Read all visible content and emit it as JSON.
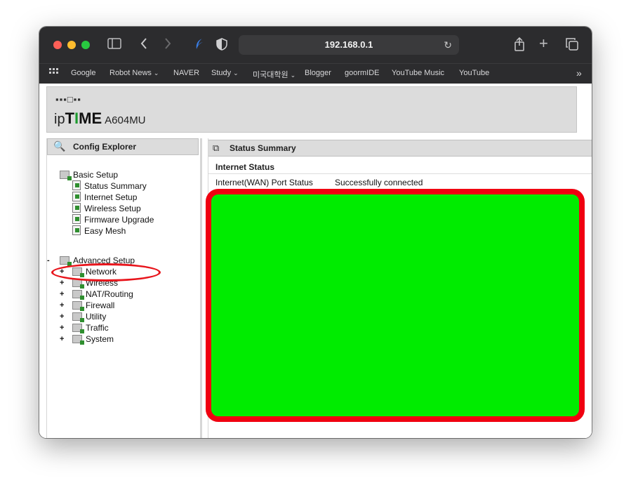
{
  "browser": {
    "address": "192.168.0.1",
    "bookmarks": [
      {
        "label": "Google"
      },
      {
        "label": "Robot News",
        "dropdown": true
      },
      {
        "label": "NAVER"
      },
      {
        "label": "Study",
        "dropdown": true
      },
      {
        "label": "미국대학원",
        "dropdown": true
      },
      {
        "label": "Blogger"
      },
      {
        "label": "goormIDE"
      },
      {
        "label": "YouTube Music"
      },
      {
        "label": "YouTube"
      }
    ]
  },
  "router": {
    "brand_prefix": "ip",
    "brand_bold": "T",
    "brand_green": "I",
    "brand_tail": "ME",
    "model": "A604MU"
  },
  "config_explorer": {
    "title": "Config Explorer",
    "basic_setup": {
      "label": "Basic Setup",
      "items": [
        "Status Summary",
        "Internet Setup",
        "Wireless Setup",
        "Firmware Upgrade",
        "Easy Mesh"
      ]
    },
    "advanced_setup": {
      "label": "Advanced Setup",
      "toggle": "-",
      "items": [
        "Network",
        "Wireless",
        "NAT/Routing",
        "Firewall",
        "Utility",
        "Traffic",
        "System"
      ]
    }
  },
  "status_summary": {
    "title": "Status Summary",
    "section": "Internet Status",
    "rows": [
      {
        "label": "Internet(WAN) Port Status",
        "value": "Successfully connected"
      }
    ]
  },
  "colors": {
    "annotation_red": "#f00010",
    "redaction_green": "#00ec00"
  }
}
